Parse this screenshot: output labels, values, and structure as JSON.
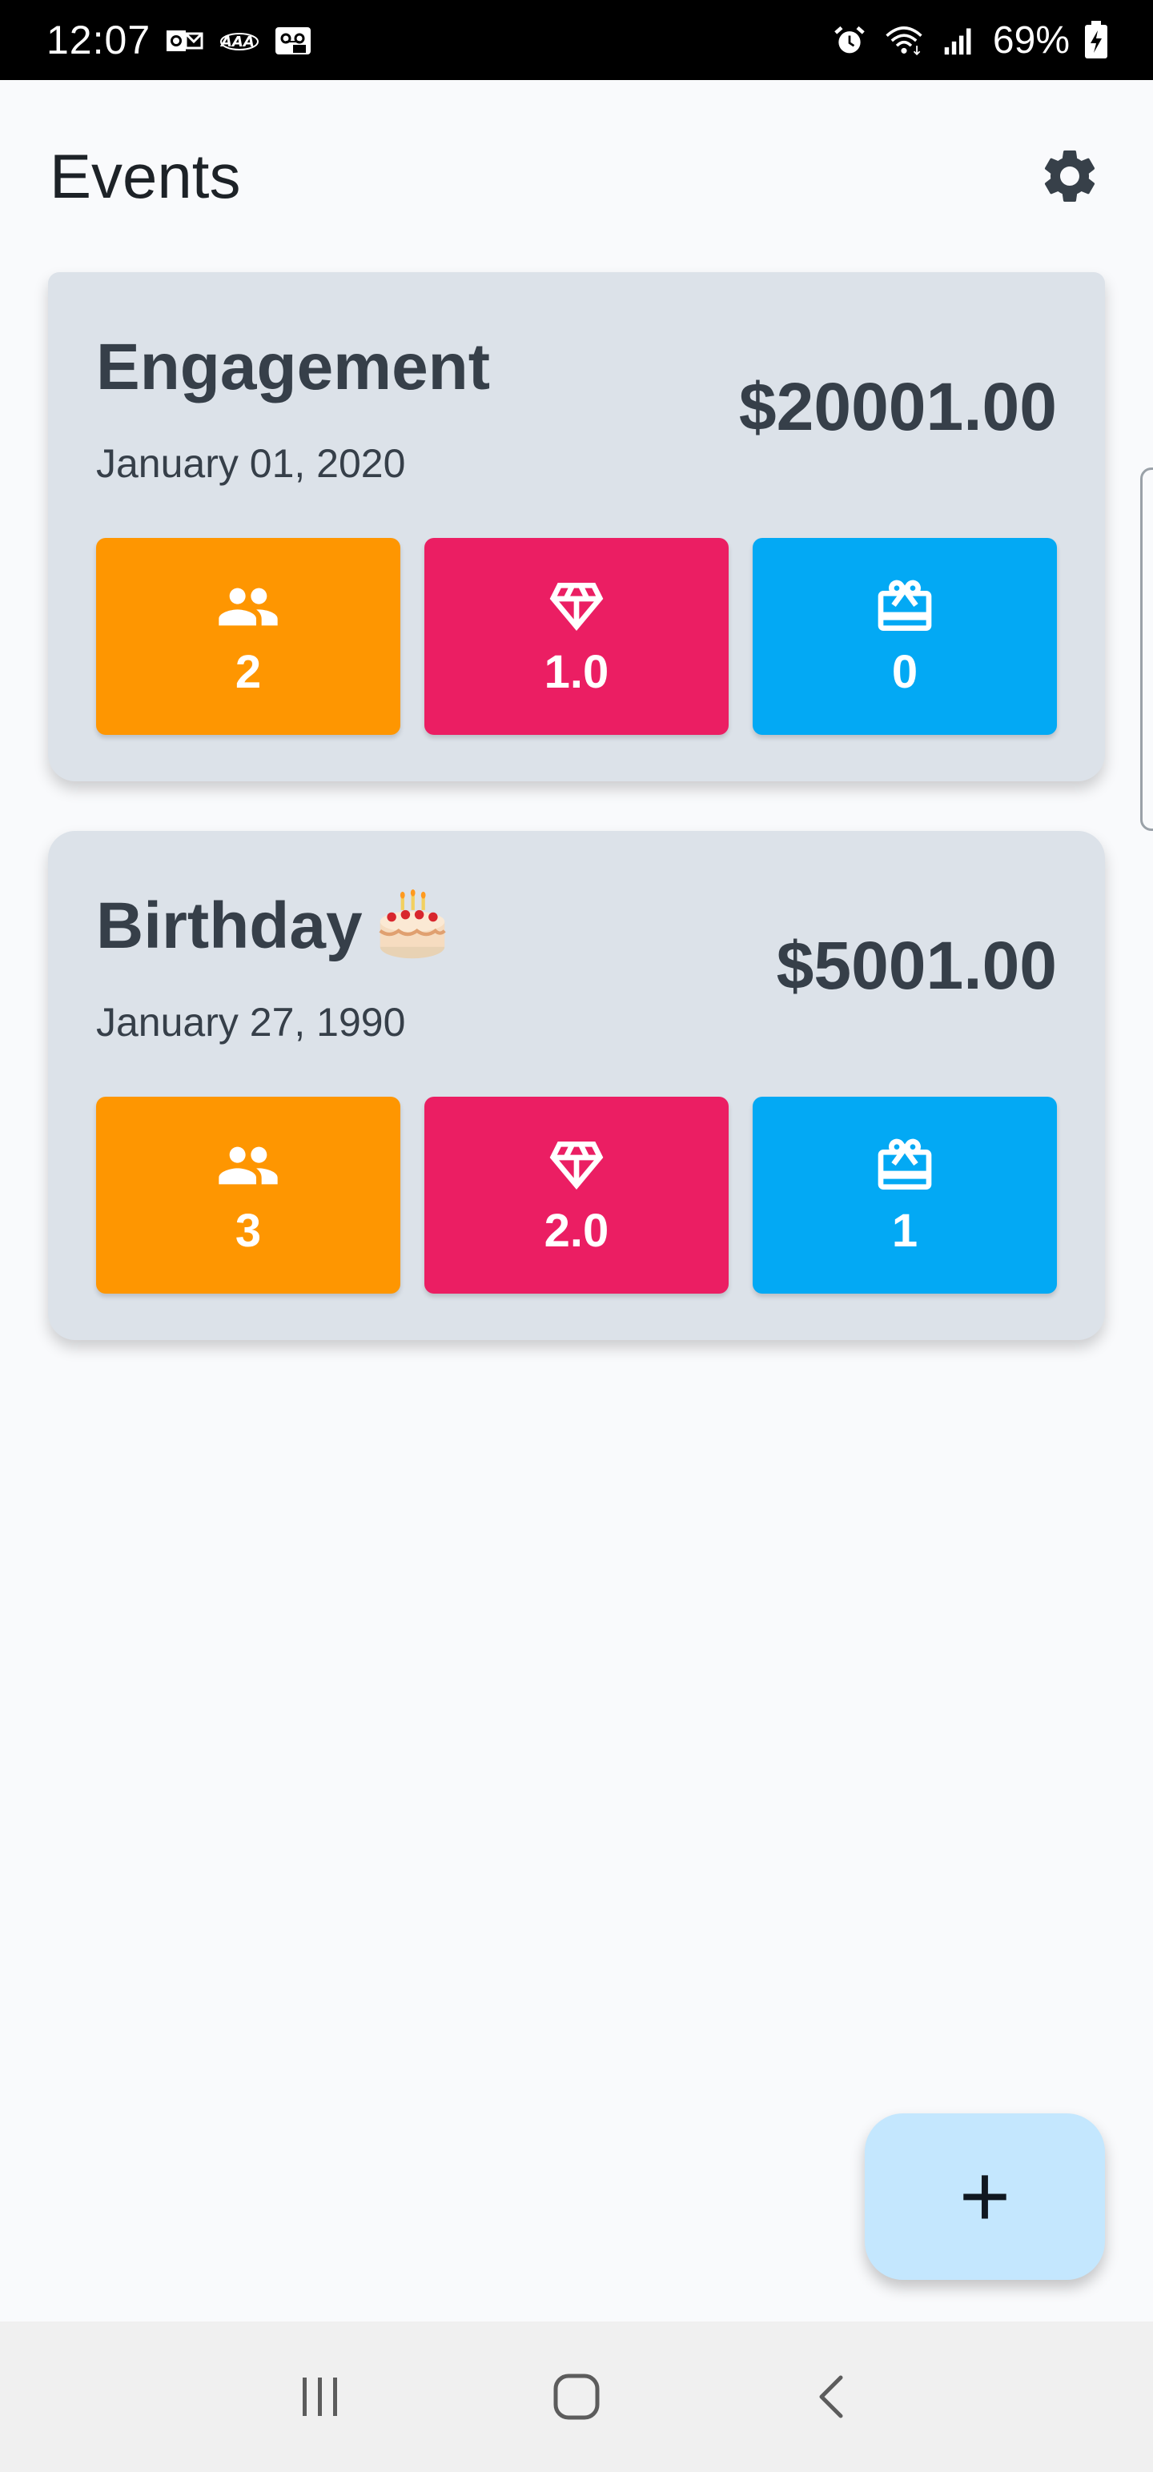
{
  "status_bar": {
    "time": "12:07",
    "battery": "69%",
    "left_icons": [
      "outlook-icon",
      "aaa-icon",
      "voicemail-icon"
    ],
    "right_icons": [
      "alarm-icon",
      "wifi-icon",
      "signal-icon",
      "battery-charging-icon"
    ]
  },
  "app_bar": {
    "title": "Events",
    "settings_icon": "gear-icon"
  },
  "events": [
    {
      "title": "Engagement",
      "date": "January 01, 2020",
      "amount": "$20001.00",
      "guests": "2",
      "points": "1.0",
      "gifts": "0"
    },
    {
      "title": "Birthday",
      "title_emoji": "birthday-cake-icon",
      "date": "January 27, 1990",
      "amount": "$5001.00",
      "guests": "3",
      "points": "2.0",
      "gifts": "1"
    }
  ],
  "colors": {
    "guests_tile": "#fe9601",
    "points_tile": "#eb1e63",
    "gifts_tile": "#03a9f4",
    "card_bg": "#dce2e9",
    "fab_bg": "#c4e7fe"
  },
  "fab": {
    "label": "+"
  },
  "nav_bar": {
    "buttons": [
      "recent-apps-icon",
      "home-icon",
      "back-icon"
    ]
  }
}
